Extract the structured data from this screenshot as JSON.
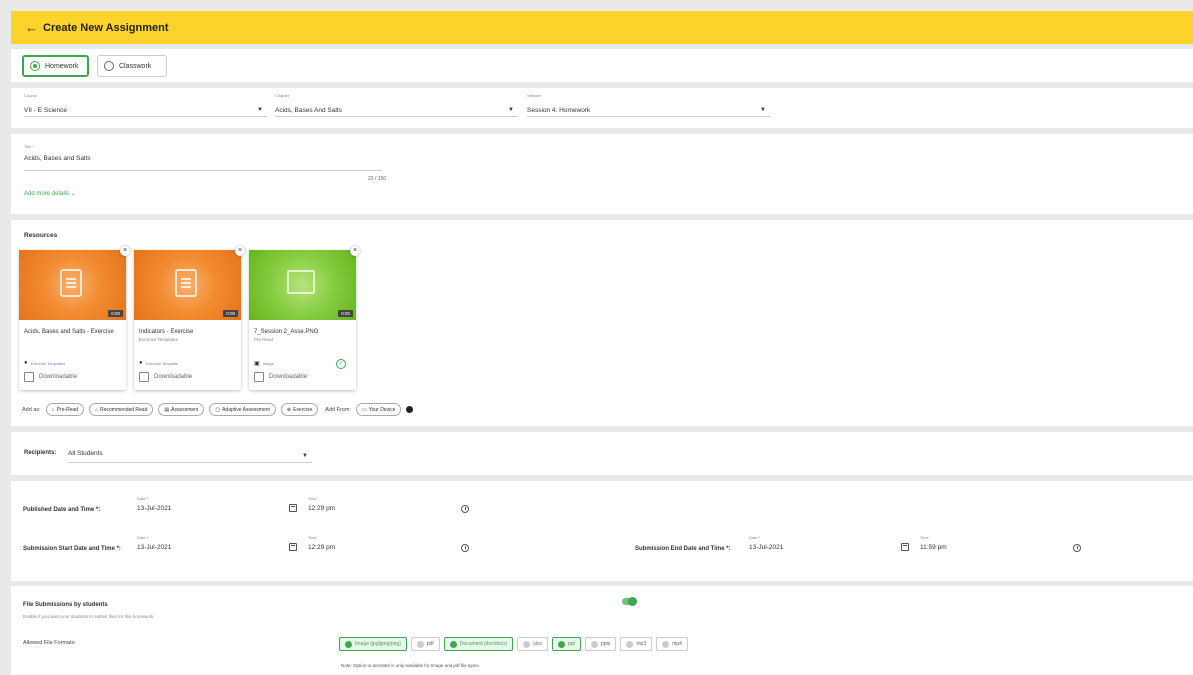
{
  "header": {
    "back_icon": "←",
    "title": "Create New Assignment"
  },
  "assignment_type": {
    "homework": "Homework",
    "classwork": "Classwork",
    "selected": "Homework"
  },
  "course": {
    "label": "Course",
    "value": "VII - E Science"
  },
  "chapter": {
    "label": "Chapter",
    "value": "Acids, Bases And Salts"
  },
  "session": {
    "label": "Session",
    "value": "Session 4: Homework"
  },
  "title_field": {
    "label": "Title *",
    "value": "Acids, Bases and Salts",
    "counter": "22 / 150"
  },
  "add_more": "Add more details",
  "resources": {
    "heading": "Resources",
    "cards": [
      {
        "title": "Acids, Bases and Salts - Exercise",
        "subtitle": "",
        "duration": "0:00",
        "type": "Exercise Templates",
        "downloadable": "Downloadable"
      },
      {
        "title": "Indicators - Exercise",
        "subtitle": "Exercise Templates",
        "duration": "0:00",
        "type": "Exercise Template",
        "downloadable": "Downloadable"
      },
      {
        "title": "7_Session 2_Asse.PNG",
        "subtitle": "Pre Read",
        "duration": "0:00",
        "type": "Image",
        "downloadable": "Downloadable"
      }
    ],
    "add_as_label": "Add as:",
    "add_as": [
      "Pre-Read",
      "Recommended Read",
      "Assessment",
      "Adaptive Assessment",
      "Exercise"
    ],
    "add_from_label": "Add From:",
    "add_from": "Your Device"
  },
  "recipients": {
    "label": "Recipients:",
    "value": "All Students"
  },
  "dates": {
    "published_label": "Published Date and Time *:",
    "published_date_label": "Date *",
    "published_date": "13-Jul-2021",
    "published_time_label": "Time",
    "published_time": "12:29 pm",
    "start_label": "Submission Start Date and Time *:",
    "start_date_label": "Date *",
    "start_date": "13-Jul-2021",
    "start_time_label": "Time",
    "start_time": "12:29 pm",
    "end_label": "Submission End Date and Time *:",
    "end_date_label": "Date *",
    "end_date": "13-Jul-2021",
    "end_time_label": "Time",
    "end_time": "11:59 pm"
  },
  "file_submissions": {
    "title": "File Submissions by students",
    "subtitle": "Enable if you want your students to submit files for this homework",
    "enabled": true,
    "formats_label": "Allowed File Formats:",
    "formats": [
      {
        "label": "Image (jpg/jpeg/png)",
        "on": true
      },
      {
        "label": "pdf",
        "on": false
      },
      {
        "label": "Document (doc/docx)",
        "on": true
      },
      {
        "label": "xlsx",
        "on": false
      },
      {
        "label": "ppt",
        "on": true
      },
      {
        "label": "pptx",
        "on": false
      },
      {
        "label": "mp3",
        "on": false
      },
      {
        "label": "mp4",
        "on": false
      }
    ],
    "note": "Note: Option to annotate is only available for Image and pdf file types."
  },
  "colors": {
    "accent": "#fbd32a",
    "green": "#3ca84e",
    "orange": "#f28b30",
    "lime": "#84cc3e"
  }
}
